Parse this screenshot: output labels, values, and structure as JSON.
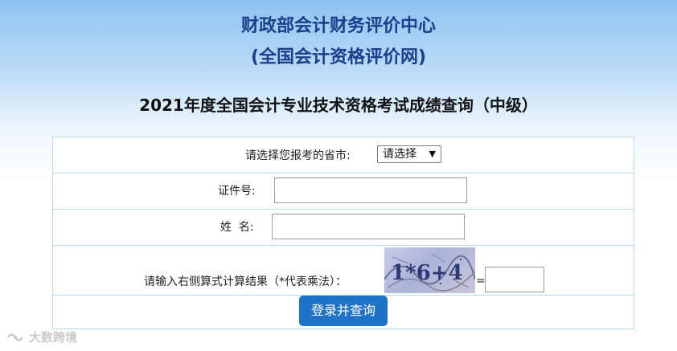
{
  "header": {
    "org_line1": "财政部会计财务评价中心",
    "org_line2": "(全国会计资格评价网)",
    "exam_title": "2021年度全国会计专业技术资格考试成绩查询（中级）"
  },
  "form": {
    "province_label": "请选择您报考的省市:",
    "province_select_value": "请选择",
    "id_label": "证件号:",
    "id_value": "",
    "name_label": "姓  名:",
    "name_value": "",
    "captcha_label": "请输入右侧算式计算结果（*代表乘法）：",
    "captcha_text": "1*6+4",
    "equals_sign": "=",
    "captcha_answer": "",
    "submit_label": "登录并查询"
  },
  "watermark": {
    "text": "大数跨境"
  },
  "colors": {
    "org_title": "#1a3f8c",
    "button": "#1e73c9",
    "table_border": "#b9d9ec"
  }
}
